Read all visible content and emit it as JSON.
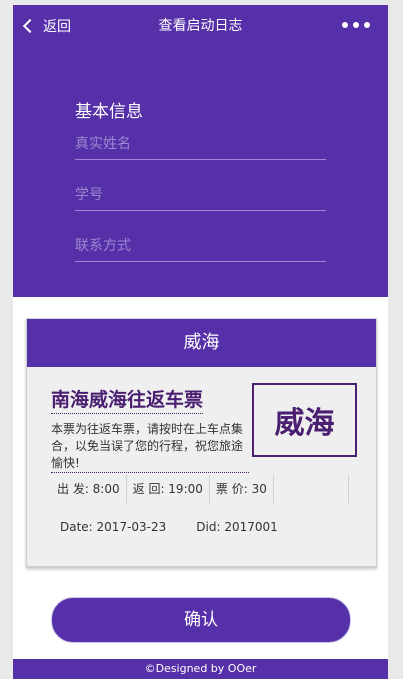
{
  "nav": {
    "back_label": "返回",
    "title": "查看启动日志"
  },
  "form": {
    "section_title": "基本信息",
    "name_placeholder": "真实姓名",
    "student_id_placeholder": "学号",
    "contact_placeholder": "联系方式"
  },
  "ticket": {
    "header": "威海",
    "title": "南海威海往返车票",
    "description": "本票为往返车票，请按时在上车点集合，以免当误了您的行程，祝您旅途愉快!",
    "stamp": "威海",
    "depart": "出 发: 8:00",
    "return": "返 回: 19:00",
    "price": "票 价: 30",
    "date": "Date: 2017-03-23",
    "did": "Did: 2017001"
  },
  "confirm_label": "确认",
  "footer": "©Designed by OOer",
  "colors": {
    "primary": "#5630a8",
    "ticket_text": "#4a1f72"
  }
}
